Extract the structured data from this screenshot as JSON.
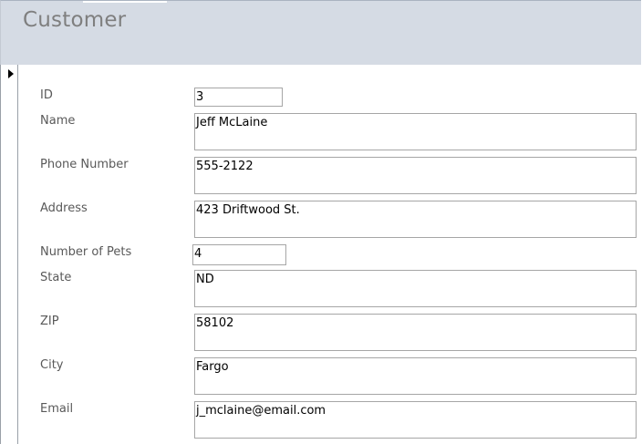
{
  "form": {
    "title": "Customer"
  },
  "fields": {
    "id": {
      "label": "ID",
      "value": "3"
    },
    "name": {
      "label": "Name",
      "value": "Jeff McLaine"
    },
    "phone": {
      "label": "Phone Number",
      "value": "555-2122"
    },
    "address": {
      "label": "Address",
      "value": "423 Driftwood St."
    },
    "pets": {
      "label": "Number of Pets",
      "value": "4"
    },
    "state": {
      "label": "State",
      "value": "ND"
    },
    "zip": {
      "label": "ZIP",
      "value": "58102"
    },
    "city": {
      "label": "City",
      "value": "Fargo"
    },
    "email": {
      "label": "Email",
      "value": "j_mclaine@email.com"
    }
  },
  "record_selector": {
    "icon": "current-record-arrow-icon"
  }
}
